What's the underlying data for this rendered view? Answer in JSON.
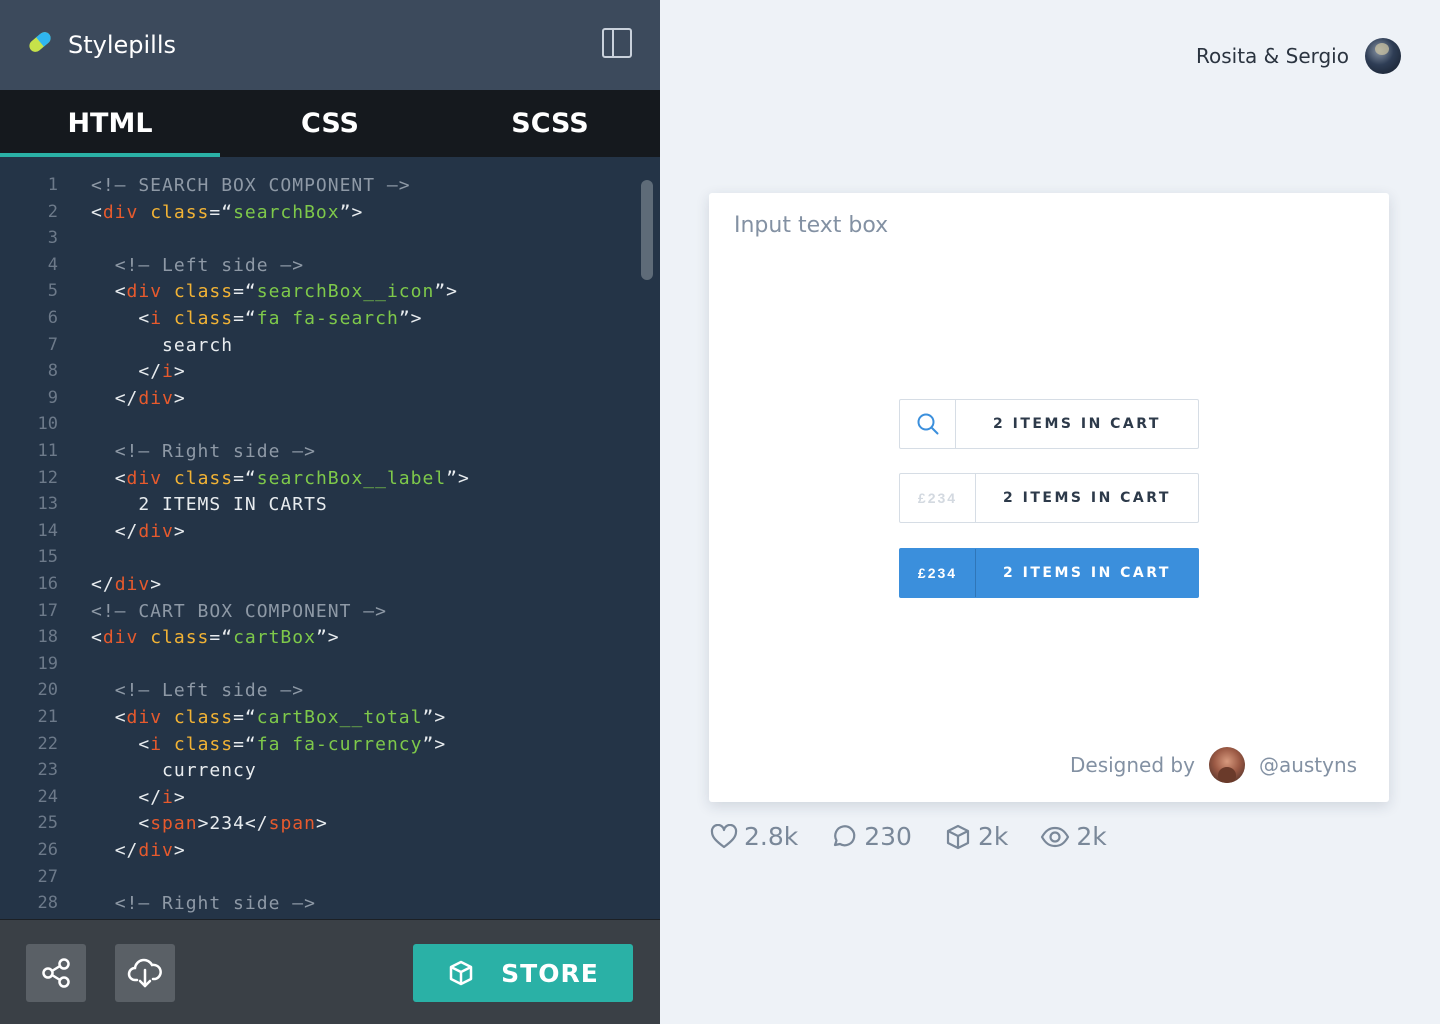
{
  "app": {
    "name": "Stylepills"
  },
  "user": {
    "name": "Rosita & Sergio"
  },
  "tabs": [
    {
      "label": "HTML",
      "active": true
    },
    {
      "label": "CSS",
      "active": false
    },
    {
      "label": "SCSS",
      "active": false
    }
  ],
  "editor": {
    "language": "HTML",
    "lines": [
      {
        "num": "1",
        "text": "<!— SEARCH BOX COMPONENT —>"
      },
      {
        "num": "2",
        "text": "<div class=“searchBox”>"
      },
      {
        "num": "3",
        "text": ""
      },
      {
        "num": "4",
        "text": "  <!— Left side —>"
      },
      {
        "num": "5",
        "text": "  <div class=“searchBox__icon”>"
      },
      {
        "num": "6",
        "text": "    <i class=“fa fa-search”>"
      },
      {
        "num": "7",
        "text": "      search"
      },
      {
        "num": "8",
        "text": "    </i>"
      },
      {
        "num": "9",
        "text": "  </div>"
      },
      {
        "num": "10",
        "text": ""
      },
      {
        "num": "11",
        "text": "  <!— Right side —>"
      },
      {
        "num": "12",
        "text": "  <div class=“searchBox__label”>"
      },
      {
        "num": "13",
        "text": "    2 ITEMS IN CARTS"
      },
      {
        "num": "14",
        "text": "  </div>"
      },
      {
        "num": "15",
        "text": ""
      },
      {
        "num": "16",
        "text": "</div>"
      },
      {
        "num": "17",
        "text": "<!— CART BOX COMPONENT —>"
      },
      {
        "num": "18",
        "text": "<div class=“cartBox”>"
      },
      {
        "num": "19",
        "text": ""
      },
      {
        "num": "20",
        "text": "  <!— Left side —>"
      },
      {
        "num": "21",
        "text": "  <div class=“cartBox__total”>"
      },
      {
        "num": "22",
        "text": "    <i class=“fa fa-currency”>"
      },
      {
        "num": "23",
        "text": "      currency"
      },
      {
        "num": "24",
        "text": "    </i>"
      },
      {
        "num": "25",
        "text": "    <span>234</span>"
      },
      {
        "num": "26",
        "text": "  </div>"
      },
      {
        "num": "27",
        "text": ""
      },
      {
        "num": "28",
        "text": "  <!— Right side —>"
      }
    ]
  },
  "bottom": {
    "store_label": "STORE"
  },
  "preview": {
    "title": "Input text box",
    "pills": [
      {
        "left": "",
        "left_icon": "search-icon",
        "right": "2 ITEMS IN CART",
        "style": "search"
      },
      {
        "left": "£234",
        "right": "2 ITEMS IN CART",
        "style": "ghost"
      },
      {
        "left": "£234",
        "right": "2 ITEMS IN CART",
        "style": "primary"
      }
    ],
    "designed_by_label": "Designed by",
    "designer_handle": "@austyns"
  },
  "stats": {
    "likes": "2.8k",
    "comments": "230",
    "stores": "2k",
    "views": "2k"
  },
  "colors": {
    "accent": "#2ab1a6",
    "primary_blue": "#3b8fdc",
    "editor_bg": "#243447"
  }
}
